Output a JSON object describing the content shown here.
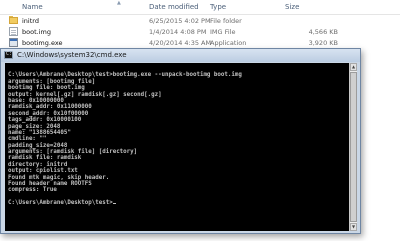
{
  "explorer": {
    "columns": {
      "name": "Name",
      "date": "Date modified",
      "type": "Type",
      "size": "Size"
    },
    "files": [
      {
        "name": "initrd",
        "date": "6/25/2015 4:02 PM",
        "type": "File folder",
        "size": "",
        "icon": "folder-icon"
      },
      {
        "name": "boot.img",
        "date": "1/4/2014 4:08 PM",
        "type": "IMG File",
        "size": "4,566 KB",
        "icon": "img-file-icon"
      },
      {
        "name": "bootimg.exe",
        "date": "4/20/2014 4:35 AM",
        "type": "Application",
        "size": "3,920 KB",
        "icon": "exe-file-icon"
      }
    ]
  },
  "cmd": {
    "title": "C:\\Windows\\system32\\cmd.exe",
    "lines": [
      "",
      "C:\\Users\\Ambrane\\Desktop\\test>bootimg.exe --unpack-bootimg boot.img",
      "arguments: [bootimg file]",
      "bootimg file: boot.img",
      "output: kernel[.gz] ramdisk[.gz] second[.gz]",
      "base: 0x10000000",
      "ramdisk_addr: 0x11000000",
      "second_addr: 0x10f00000",
      "tags_addr: 0x10000100",
      "page_size: 2048",
      "name: \"1388654405\"",
      "cmdline: \"\"",
      "padding_size=2048",
      "arguments: [ramdisk file] [directory]",
      "ramdisk file: ramdisk",
      "directory: initrd",
      "output: cpiolist.txt",
      "Found mtk magic, skip header.",
      "Found header name ROOTFS",
      "compress: True",
      "",
      "C:\\Users\\Ambrane\\Desktop\\test>"
    ]
  }
}
